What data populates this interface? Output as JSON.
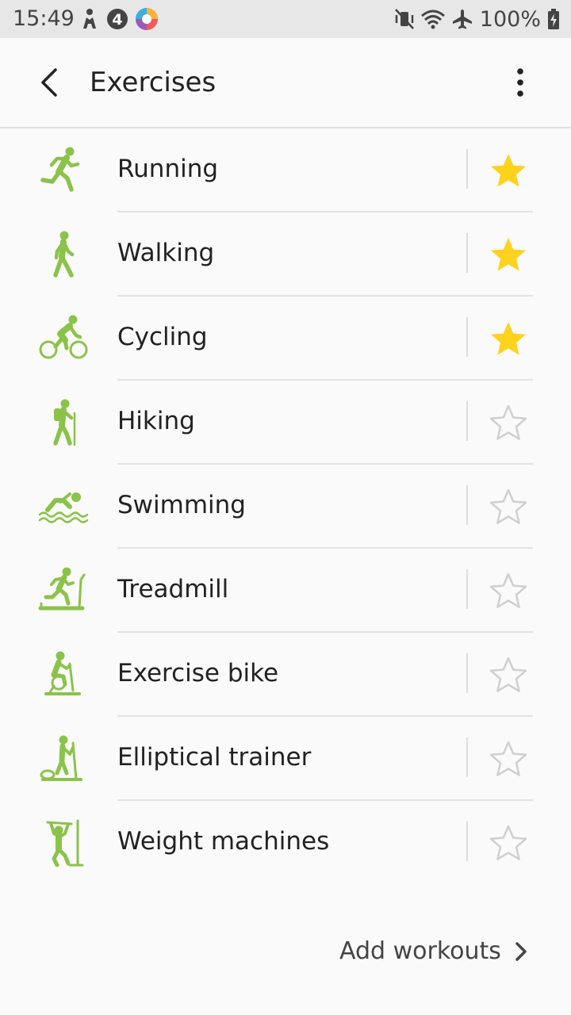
{
  "status_bar": {
    "time": "15:49",
    "battery": "100%",
    "icons": [
      "accessibility-icon",
      "badge-4-icon",
      "photos-app-icon",
      "mute-vibrate-icon",
      "wifi-icon",
      "airplane-icon",
      "battery-charging-icon"
    ]
  },
  "app_bar": {
    "title": "Exercises",
    "back_icon": "back-arrow-icon",
    "more_icon": "more-vertical-icon"
  },
  "colors": {
    "accent_green": "#8bc34a",
    "star_filled": "#ffd21e",
    "star_empty": "#cfcfcf"
  },
  "exercises": [
    {
      "label": "Running",
      "icon": "running-icon",
      "favorite": true
    },
    {
      "label": "Walking",
      "icon": "walking-icon",
      "favorite": true
    },
    {
      "label": "Cycling",
      "icon": "cycling-icon",
      "favorite": true
    },
    {
      "label": "Hiking",
      "icon": "hiking-icon",
      "favorite": false
    },
    {
      "label": "Swimming",
      "icon": "swimming-icon",
      "favorite": false
    },
    {
      "label": "Treadmill",
      "icon": "treadmill-icon",
      "favorite": false
    },
    {
      "label": "Exercise bike",
      "icon": "exercise-bike-icon",
      "favorite": false
    },
    {
      "label": "Elliptical trainer",
      "icon": "elliptical-trainer-icon",
      "favorite": false
    },
    {
      "label": "Weight machines",
      "icon": "weight-machines-icon",
      "favorite": false
    }
  ],
  "footer": {
    "add_workouts_label": "Add workouts",
    "chevron_icon": "chevron-right-icon"
  }
}
